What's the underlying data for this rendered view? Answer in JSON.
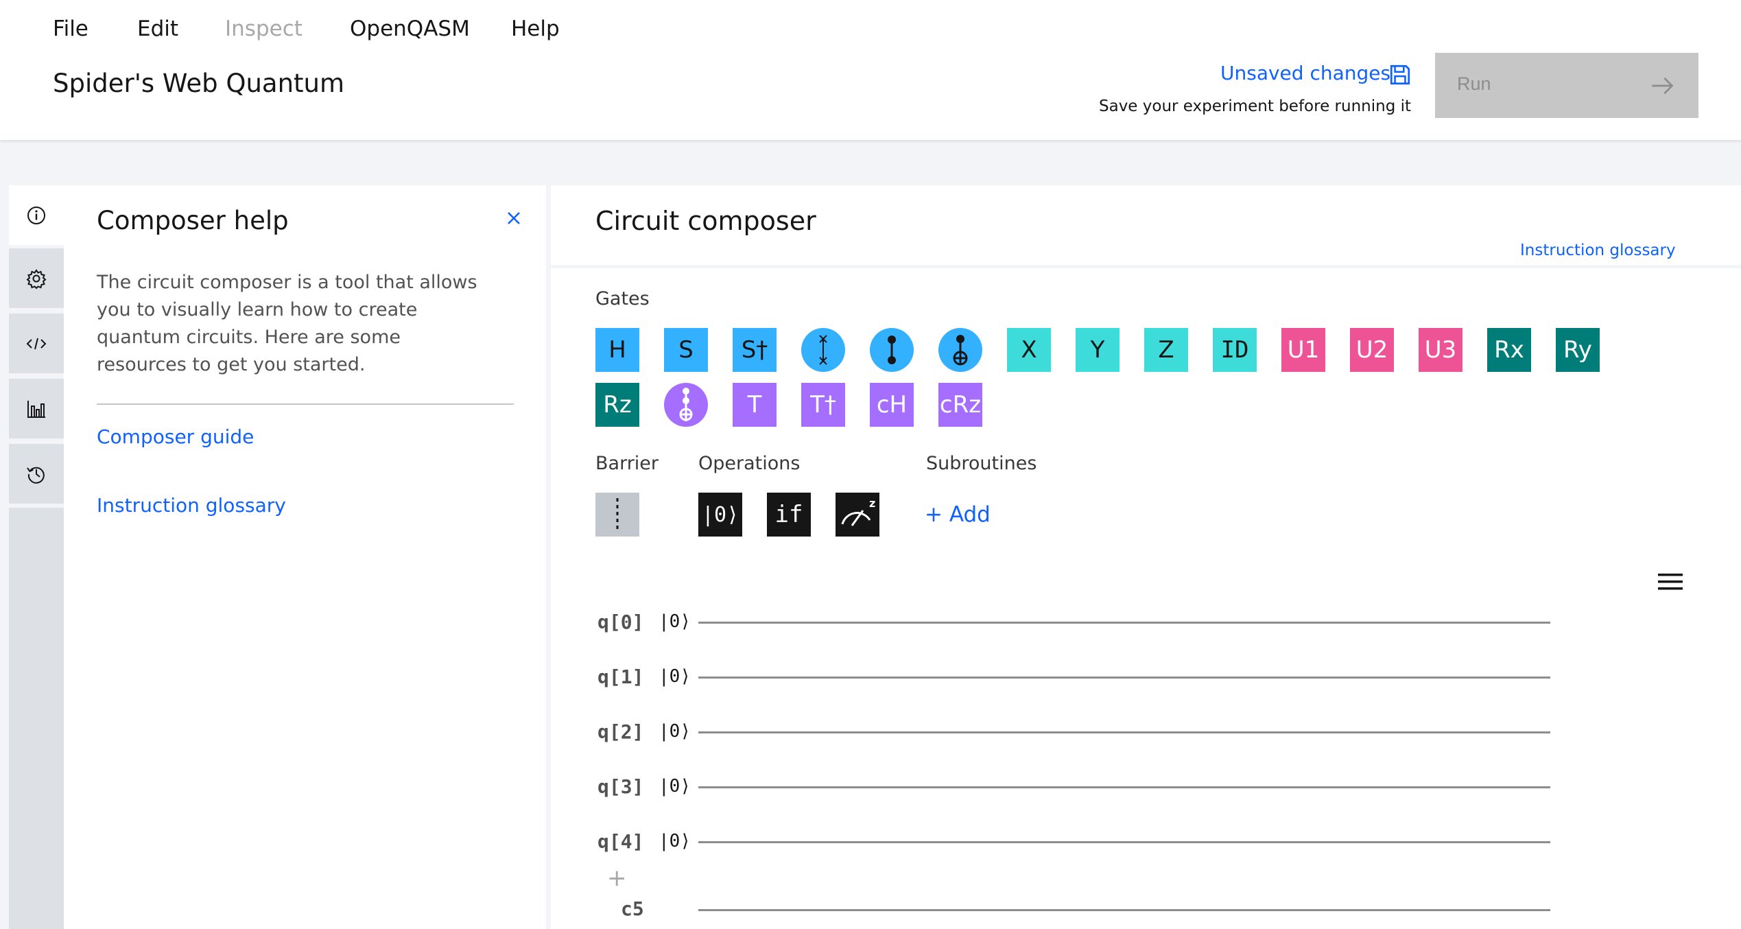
{
  "menu": {
    "items": [
      {
        "label": "File",
        "enabled": true
      },
      {
        "label": "Edit",
        "enabled": true
      },
      {
        "label": "Inspect",
        "enabled": false
      },
      {
        "label": "OpenQASM",
        "enabled": true
      },
      {
        "label": "Help",
        "enabled": true
      }
    ]
  },
  "header": {
    "title": "Spider's Web Quantum",
    "unsaved_label": "Unsaved changes",
    "save_hint": "Save your experiment before running it",
    "run_label": "Run"
  },
  "rail": {
    "icons": [
      "info-icon",
      "settings-icon",
      "code-icon",
      "histogram-icon",
      "history-icon"
    ],
    "active": "info-icon"
  },
  "help_panel": {
    "title": "Composer help",
    "description": "The circuit composer is a tool that allows you to visually learn how to create quantum circuits. Here are some resources to get you started.",
    "links": [
      "Composer guide",
      "Instruction glossary"
    ]
  },
  "composer": {
    "title": "Circuit composer",
    "glossary_link": "Instruction glossary",
    "gates_label": "Gates",
    "barrier_label": "Barrier",
    "operations_label": "Operations",
    "subroutines_label": "Subroutines",
    "add_subroutine": "+ Add",
    "gates_row1": [
      "H",
      "S",
      "S†",
      "swap",
      "cz",
      "cx",
      "X",
      "Y",
      "Z",
      "ID",
      "U1",
      "U2",
      "U3",
      "Rx",
      "Ry"
    ],
    "gates_row2": [
      "Rz",
      "ccx",
      "T",
      "T†",
      "cH",
      "cRz"
    ],
    "operations": [
      "|0⟩",
      "if",
      "measure"
    ],
    "add_qubit": "+",
    "qubits": [
      {
        "label": "q[0]",
        "init": "|0⟩"
      },
      {
        "label": "q[1]",
        "init": "|0⟩"
      },
      {
        "label": "q[2]",
        "init": "|0⟩"
      },
      {
        "label": "q[3]",
        "init": "|0⟩"
      },
      {
        "label": "q[4]",
        "init": "|0⟩"
      }
    ],
    "classical": {
      "label": "c5"
    }
  },
  "colors": {
    "accent": "#0f62fe",
    "gate_blue": "#33b1ff",
    "gate_teal": "#3ddbd9",
    "gate_pink": "#ee5396",
    "gate_dark_teal": "#007d79",
    "gate_purple": "#a56eff",
    "op_dark": "#161616",
    "run_disabled": "#c6c6c6"
  }
}
